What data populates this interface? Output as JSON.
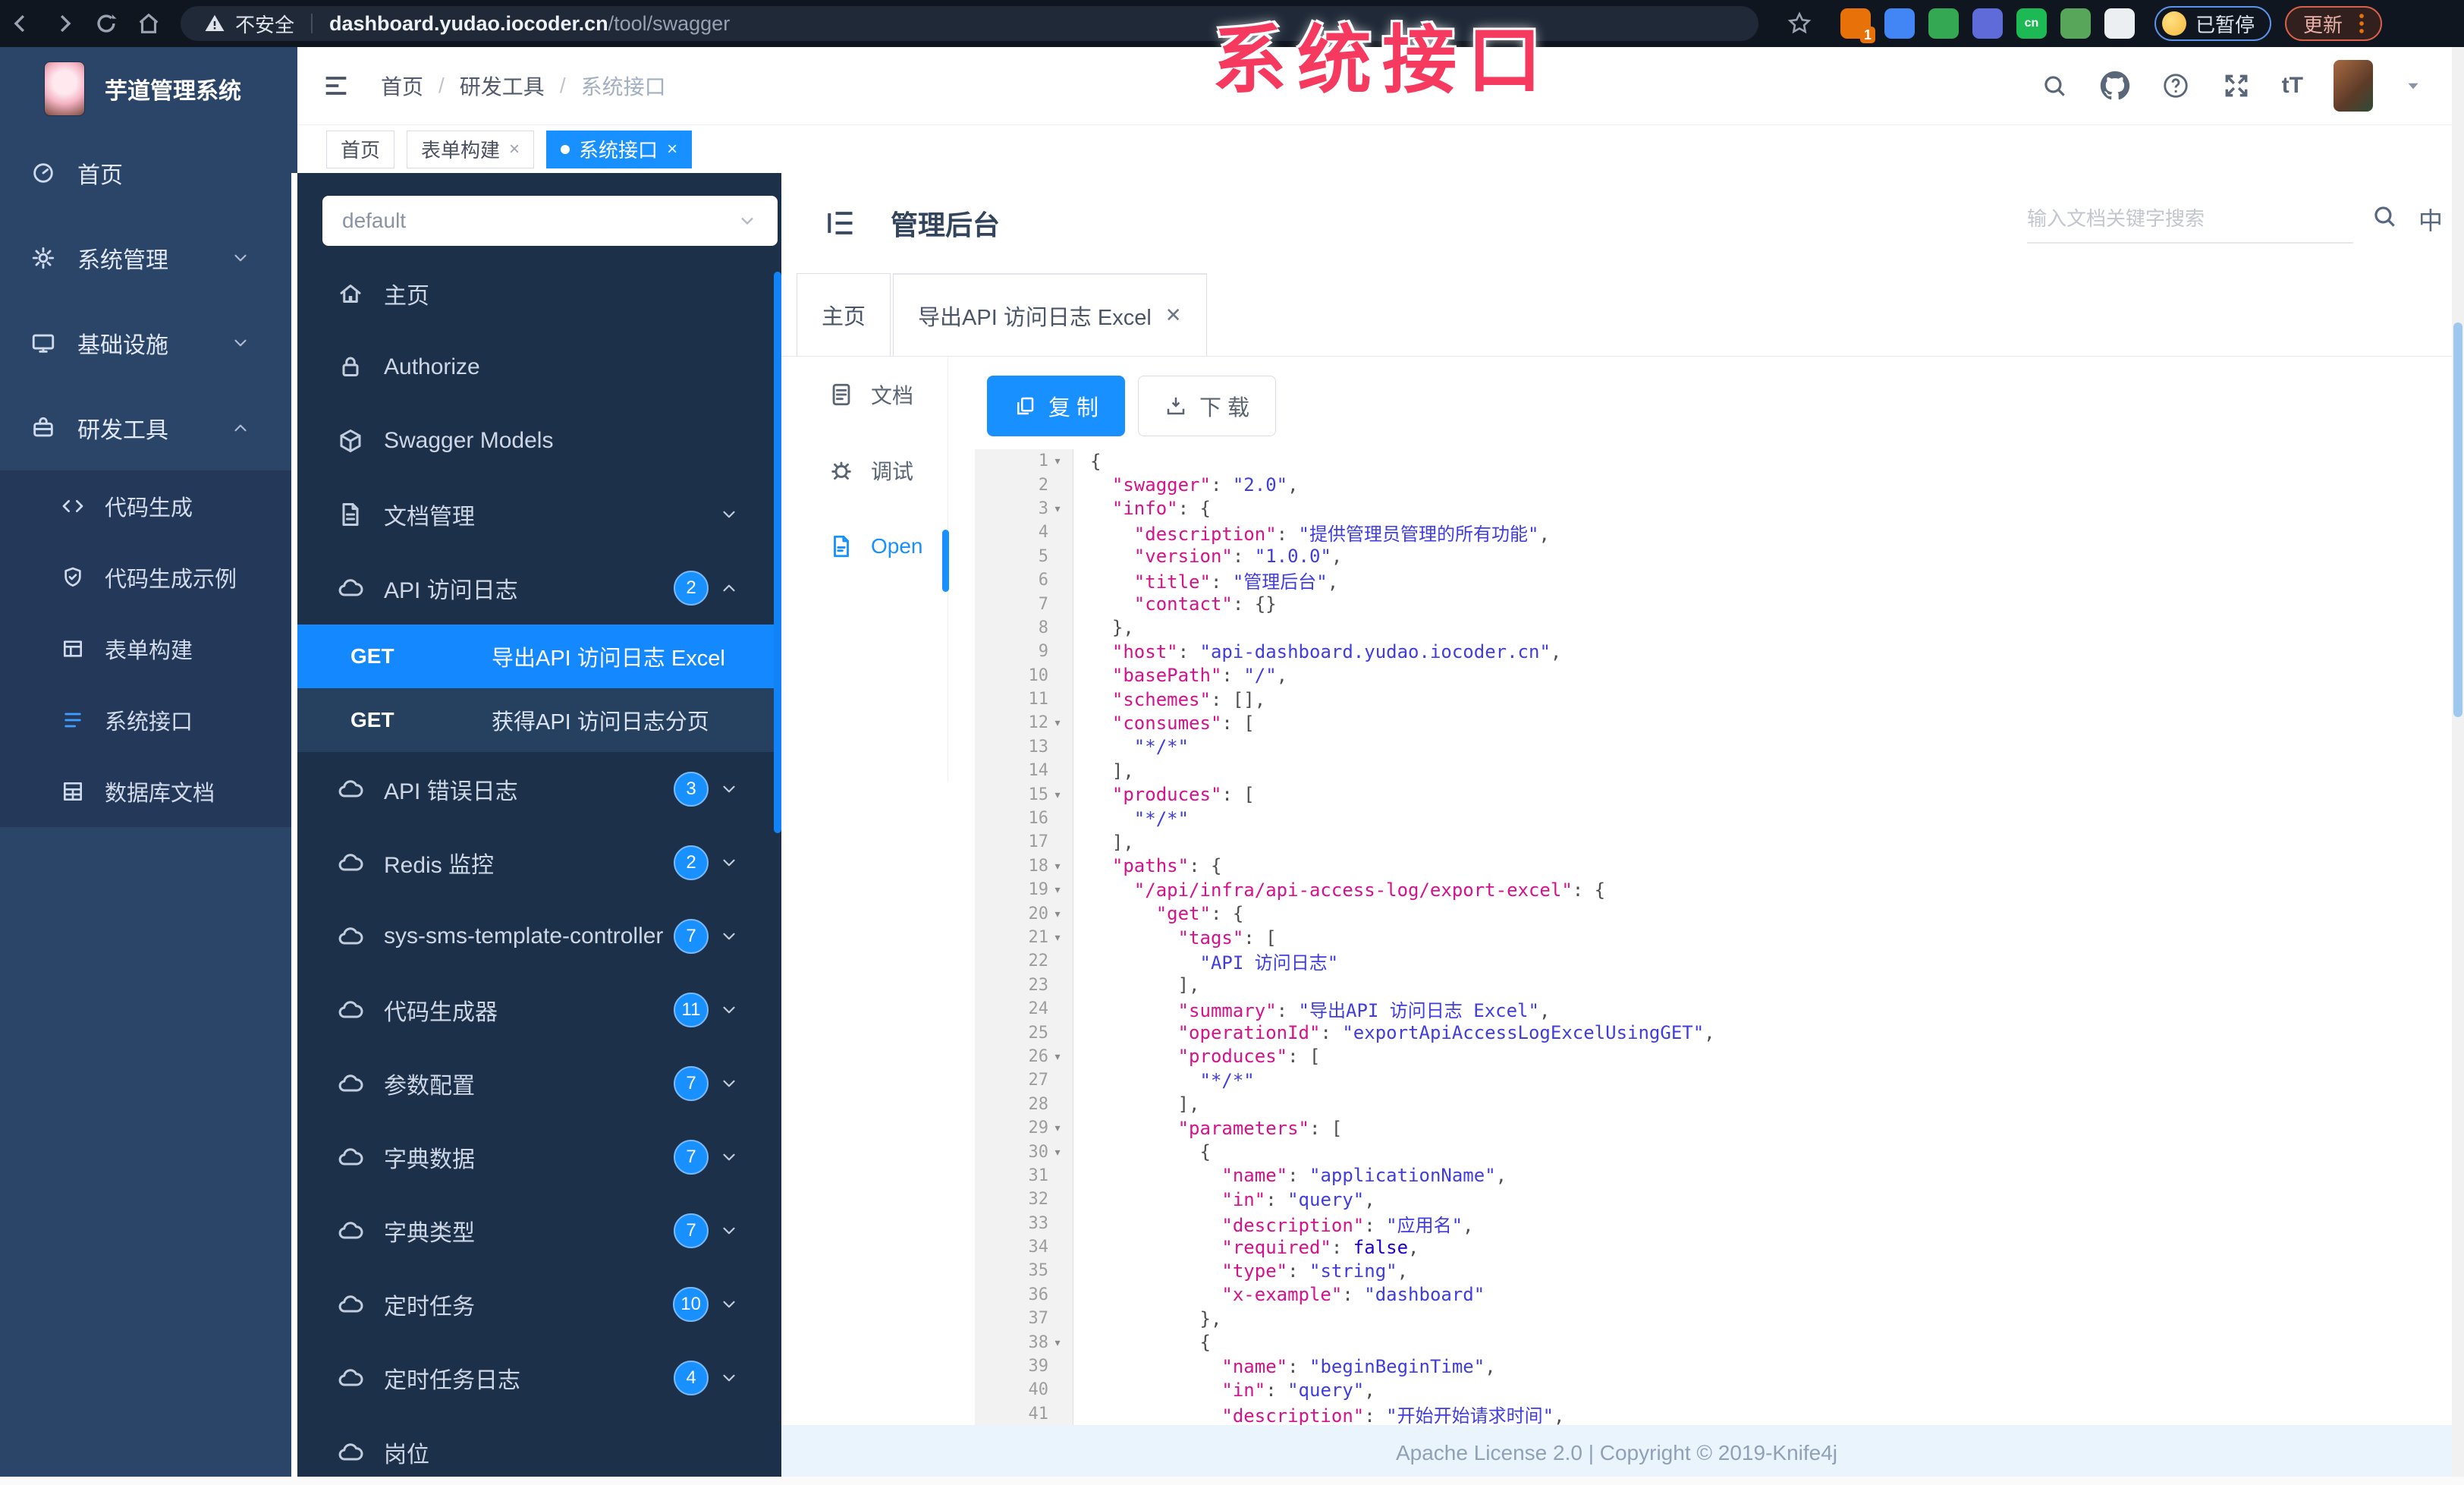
{
  "browser": {
    "security_label": "不安全",
    "url_host": "dashboard.yudao.iocoder.cn",
    "url_path": "/tool/swagger",
    "paused_label": "已暂停",
    "update_label": "更新",
    "extensions": [
      {
        "name": "extension-orange",
        "color": "#e8710a",
        "badge": "1"
      },
      {
        "name": "extension-pin-blue",
        "color": "#4285f4"
      },
      {
        "name": "extension-green-ring",
        "color": "#34a853"
      },
      {
        "name": "extension-grid-blue",
        "color": "#5f6bd8"
      },
      {
        "name": "extension-cn-green",
        "color": "#1db954",
        "text": "cn"
      },
      {
        "name": "extension-leaf",
        "color": "#57a65a"
      },
      {
        "name": "extension-paw-white",
        "color": "#eceff1"
      }
    ]
  },
  "overlay": {
    "title": "系统接口"
  },
  "sidebar": {
    "logo_title": "芋道管理系统",
    "items": [
      {
        "slug": "home",
        "label": "首页",
        "icon": "dashboard-icon"
      },
      {
        "slug": "system",
        "label": "系统管理",
        "icon": "gear-icon",
        "chevron": "down"
      },
      {
        "slug": "infra",
        "label": "基础设施",
        "icon": "monitor-icon",
        "chevron": "down"
      },
      {
        "slug": "devtools",
        "label": "研发工具",
        "icon": "toolbox-icon",
        "chevron": "up",
        "expanded": true,
        "children": [
          {
            "slug": "codegen",
            "label": "代码生成",
            "icon": "code-icon"
          },
          {
            "slug": "codegen-demo",
            "label": "代码生成示例",
            "icon": "shield-icon"
          },
          {
            "slug": "form-builder",
            "label": "表单构建",
            "icon": "form-grid-icon"
          },
          {
            "slug": "system-api",
            "label": "系统接口",
            "icon": "api-lines-icon",
            "active": true
          },
          {
            "slug": "db-doc",
            "label": "数据库文档",
            "icon": "database-icon"
          }
        ]
      }
    ]
  },
  "topbar": {
    "breadcrumb": [
      "首页",
      "研发工具",
      "系统接口"
    ]
  },
  "tags": [
    {
      "slug": "home",
      "label": "首页"
    },
    {
      "slug": "form-builder",
      "label": "表单构建",
      "closable": true
    },
    {
      "slug": "system-api",
      "label": "系统接口",
      "closable": true,
      "active": true
    }
  ],
  "swagger": {
    "select_value": "default",
    "items": [
      {
        "slug": "home",
        "label": "主页",
        "icon": "home-icon"
      },
      {
        "slug": "authorize",
        "label": "Authorize",
        "icon": "lock-icon"
      },
      {
        "slug": "swagger-models",
        "label": "Swagger Models",
        "icon": "cube-icon"
      },
      {
        "slug": "doc-manage",
        "label": "文档管理",
        "icon": "file-icon",
        "chevron": "down"
      },
      {
        "slug": "api-access-log",
        "label": "API 访问日志",
        "icon": "cloud-icon",
        "badge": "2",
        "chevron": "up",
        "expanded": true,
        "children": [
          {
            "method": "GET",
            "label": "导出API 访问日志 Excel",
            "selected": true
          },
          {
            "method": "GET",
            "label": "获得API 访问日志分页"
          }
        ]
      },
      {
        "slug": "api-error-log",
        "label": "API 错误日志",
        "icon": "cloud-icon",
        "badge": "3",
        "chevron": "down"
      },
      {
        "slug": "redis-monitor",
        "label": "Redis 监控",
        "icon": "cloud-icon",
        "badge": "2",
        "chevron": "down"
      },
      {
        "slug": "sms-template",
        "label": "sys-sms-template-controller",
        "icon": "cloud-icon",
        "badge": "7",
        "chevron": "down"
      },
      {
        "slug": "codegen",
        "label": "代码生成器",
        "icon": "cloud-icon",
        "badge": "11",
        "chevron": "down"
      },
      {
        "slug": "param-config",
        "label": "参数配置",
        "icon": "cloud-icon",
        "badge": "7",
        "chevron": "down"
      },
      {
        "slug": "dict-data",
        "label": "字典数据",
        "icon": "cloud-icon",
        "badge": "7",
        "chevron": "down"
      },
      {
        "slug": "dict-type",
        "label": "字典类型",
        "icon": "cloud-icon",
        "badge": "7",
        "chevron": "down"
      },
      {
        "slug": "cron-job",
        "label": "定时任务",
        "icon": "cloud-icon",
        "badge": "10",
        "chevron": "down"
      },
      {
        "slug": "cron-job-log",
        "label": "定时任务日志",
        "icon": "cloud-icon",
        "badge": "4",
        "chevron": "down"
      },
      {
        "slug": "post",
        "label": "岗位",
        "icon": "cloud-icon",
        "badge": "",
        "partial": true
      }
    ]
  },
  "main": {
    "title": "管理后台",
    "search_placeholder": "输入文档关键字搜索",
    "lang_icon": "中",
    "tabs": [
      {
        "slug": "home",
        "label": "主页"
      },
      {
        "slug": "export-excel",
        "label": "导出API 访问日志 Excel",
        "closable": true,
        "active": true
      }
    ],
    "rail": [
      {
        "slug": "doc",
        "label": "文档",
        "icon": "document-icon"
      },
      {
        "slug": "debug",
        "label": "调试",
        "icon": "bug-icon"
      },
      {
        "slug": "open",
        "label": "Open",
        "icon": "open-file-icon",
        "active": true
      }
    ],
    "copy_label": "复 制",
    "download_label": "下 载",
    "footer": "Apache License 2.0 | Copyright © 2019-Knife4j"
  },
  "code": {
    "lines": [
      {
        "n": 1,
        "f": 1,
        "i": 0,
        "t": [
          [
            "p",
            "{"
          ]
        ]
      },
      {
        "n": 2,
        "i": 1,
        "t": [
          [
            "k",
            "\"swagger\""
          ],
          [
            "p",
            ": "
          ],
          [
            "s",
            "\"2.0\""
          ],
          [
            "p",
            ","
          ]
        ]
      },
      {
        "n": 3,
        "f": 1,
        "i": 1,
        "t": [
          [
            "k",
            "\"info\""
          ],
          [
            "p",
            ": {"
          ]
        ]
      },
      {
        "n": 4,
        "i": 2,
        "t": [
          [
            "k",
            "\"description\""
          ],
          [
            "p",
            ": "
          ],
          [
            "s",
            "\"提供管理员管理的所有功能\""
          ],
          [
            "p",
            ","
          ]
        ]
      },
      {
        "n": 5,
        "i": 2,
        "t": [
          [
            "k",
            "\"version\""
          ],
          [
            "p",
            ": "
          ],
          [
            "s",
            "\"1.0.0\""
          ],
          [
            "p",
            ","
          ]
        ]
      },
      {
        "n": 6,
        "i": 2,
        "t": [
          [
            "k",
            "\"title\""
          ],
          [
            "p",
            ": "
          ],
          [
            "s",
            "\"管理后台\""
          ],
          [
            "p",
            ","
          ]
        ]
      },
      {
        "n": 7,
        "i": 2,
        "t": [
          [
            "k",
            "\"contact\""
          ],
          [
            "p",
            ": {}"
          ]
        ]
      },
      {
        "n": 8,
        "i": 1,
        "t": [
          [
            "p",
            "},"
          ]
        ]
      },
      {
        "n": 9,
        "i": 1,
        "t": [
          [
            "k",
            "\"host\""
          ],
          [
            "p",
            ": "
          ],
          [
            "s",
            "\"api-dashboard.yudao.iocoder.cn\""
          ],
          [
            "p",
            ","
          ]
        ]
      },
      {
        "n": 10,
        "i": 1,
        "t": [
          [
            "k",
            "\"basePath\""
          ],
          [
            "p",
            ": "
          ],
          [
            "s",
            "\"/\""
          ],
          [
            "p",
            ","
          ]
        ]
      },
      {
        "n": 11,
        "i": 1,
        "t": [
          [
            "k",
            "\"schemes\""
          ],
          [
            "p",
            ": [],"
          ]
        ]
      },
      {
        "n": 12,
        "f": 1,
        "i": 1,
        "t": [
          [
            "k",
            "\"consumes\""
          ],
          [
            "p",
            ": ["
          ]
        ]
      },
      {
        "n": 13,
        "i": 2,
        "t": [
          [
            "s",
            "\"*/*\""
          ]
        ]
      },
      {
        "n": 14,
        "i": 1,
        "t": [
          [
            "p",
            "],"
          ]
        ]
      },
      {
        "n": 15,
        "f": 1,
        "i": 1,
        "t": [
          [
            "k",
            "\"produces\""
          ],
          [
            "p",
            ": ["
          ]
        ]
      },
      {
        "n": 16,
        "i": 2,
        "t": [
          [
            "s",
            "\"*/*\""
          ]
        ]
      },
      {
        "n": 17,
        "i": 1,
        "t": [
          [
            "p",
            "],"
          ]
        ]
      },
      {
        "n": 18,
        "f": 1,
        "i": 1,
        "t": [
          [
            "k",
            "\"paths\""
          ],
          [
            "p",
            ": {"
          ]
        ]
      },
      {
        "n": 19,
        "f": 1,
        "i": 2,
        "t": [
          [
            "k",
            "\"/api/infra/api-access-log/export-excel\""
          ],
          [
            "p",
            ": {"
          ]
        ]
      },
      {
        "n": 20,
        "f": 1,
        "i": 3,
        "t": [
          [
            "k",
            "\"get\""
          ],
          [
            "p",
            ": {"
          ]
        ]
      },
      {
        "n": 21,
        "f": 1,
        "i": 4,
        "t": [
          [
            "k",
            "\"tags\""
          ],
          [
            "p",
            ": ["
          ]
        ]
      },
      {
        "n": 22,
        "i": 5,
        "t": [
          [
            "s",
            "\"API 访问日志\""
          ]
        ]
      },
      {
        "n": 23,
        "i": 4,
        "t": [
          [
            "p",
            "],"
          ]
        ]
      },
      {
        "n": 24,
        "i": 4,
        "t": [
          [
            "k",
            "\"summary\""
          ],
          [
            "p",
            ": "
          ],
          [
            "s",
            "\"导出API 访问日志 Excel\""
          ],
          [
            "p",
            ","
          ]
        ]
      },
      {
        "n": 25,
        "i": 4,
        "t": [
          [
            "k",
            "\"operationId\""
          ],
          [
            "p",
            ": "
          ],
          [
            "s",
            "\"exportApiAccessLogExcelUsingGET\""
          ],
          [
            "p",
            ","
          ]
        ]
      },
      {
        "n": 26,
        "f": 1,
        "i": 4,
        "t": [
          [
            "k",
            "\"produces\""
          ],
          [
            "p",
            ": ["
          ]
        ]
      },
      {
        "n": 27,
        "i": 5,
        "t": [
          [
            "s",
            "\"*/*\""
          ]
        ]
      },
      {
        "n": 28,
        "i": 4,
        "t": [
          [
            "p",
            "],"
          ]
        ]
      },
      {
        "n": 29,
        "f": 1,
        "i": 4,
        "t": [
          [
            "k",
            "\"parameters\""
          ],
          [
            "p",
            ": ["
          ]
        ]
      },
      {
        "n": 30,
        "f": 1,
        "i": 5,
        "t": [
          [
            "p",
            "{"
          ]
        ]
      },
      {
        "n": 31,
        "i": 6,
        "t": [
          [
            "k",
            "\"name\""
          ],
          [
            "p",
            ": "
          ],
          [
            "s",
            "\"applicationName\""
          ],
          [
            "p",
            ","
          ]
        ]
      },
      {
        "n": 32,
        "i": 6,
        "t": [
          [
            "k",
            "\"in\""
          ],
          [
            "p",
            ": "
          ],
          [
            "s",
            "\"query\""
          ],
          [
            "p",
            ","
          ]
        ]
      },
      {
        "n": 33,
        "i": 6,
        "t": [
          [
            "k",
            "\"description\""
          ],
          [
            "p",
            ": "
          ],
          [
            "s",
            "\"应用名\""
          ],
          [
            "p",
            ","
          ]
        ]
      },
      {
        "n": 34,
        "i": 6,
        "t": [
          [
            "k",
            "\"required\""
          ],
          [
            "p",
            ": "
          ],
          [
            "b",
            "false"
          ],
          [
            "p",
            ","
          ]
        ]
      },
      {
        "n": 35,
        "i": 6,
        "t": [
          [
            "k",
            "\"type\""
          ],
          [
            "p",
            ": "
          ],
          [
            "s",
            "\"string\""
          ],
          [
            "p",
            ","
          ]
        ]
      },
      {
        "n": 36,
        "i": 6,
        "t": [
          [
            "k",
            "\"x-example\""
          ],
          [
            "p",
            ": "
          ],
          [
            "s",
            "\"dashboard\""
          ]
        ]
      },
      {
        "n": 37,
        "i": 5,
        "t": [
          [
            "p",
            "},"
          ]
        ]
      },
      {
        "n": 38,
        "f": 1,
        "i": 5,
        "t": [
          [
            "p",
            "{"
          ]
        ]
      },
      {
        "n": 39,
        "i": 6,
        "t": [
          [
            "k",
            "\"name\""
          ],
          [
            "p",
            ": "
          ],
          [
            "s",
            "\"beginBeginTime\""
          ],
          [
            "p",
            ","
          ]
        ]
      },
      {
        "n": 40,
        "i": 6,
        "t": [
          [
            "k",
            "\"in\""
          ],
          [
            "p",
            ": "
          ],
          [
            "s",
            "\"query\""
          ],
          [
            "p",
            ","
          ]
        ]
      },
      {
        "n": 41,
        "i": 6,
        "t": [
          [
            "k",
            "\"description\""
          ],
          [
            "p",
            ": "
          ],
          [
            "s",
            "\"开始开始请求时间\""
          ],
          [
            "p",
            ","
          ]
        ]
      }
    ]
  }
}
